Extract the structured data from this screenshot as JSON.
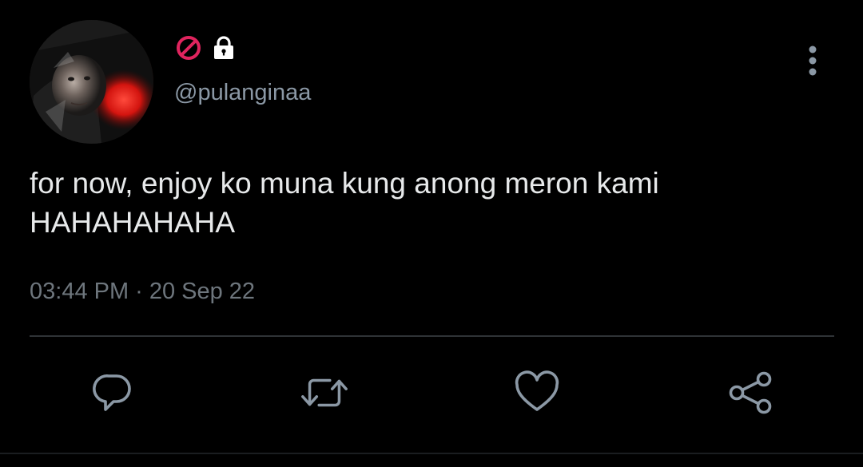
{
  "user": {
    "handle": "@pulanginaa",
    "badges": [
      "blocked-icon",
      "lock-icon"
    ]
  },
  "tweet": {
    "text_lines": [
      "for now, enjoy ko muna kung anong meron kami",
      "HAHAHAHAHA"
    ],
    "time": "03:44 PM",
    "separator": "·",
    "date": "20 Sep 22"
  },
  "actions": [
    "reply-icon",
    "retweet-icon",
    "like-icon",
    "share-icon"
  ],
  "colors": {
    "background": "#000000",
    "text": "#e7e9ea",
    "secondary_text": "#8b98a5",
    "icon": "#8b98a5",
    "blocked_badge": "#e0245e",
    "divider": "#2f3336"
  }
}
